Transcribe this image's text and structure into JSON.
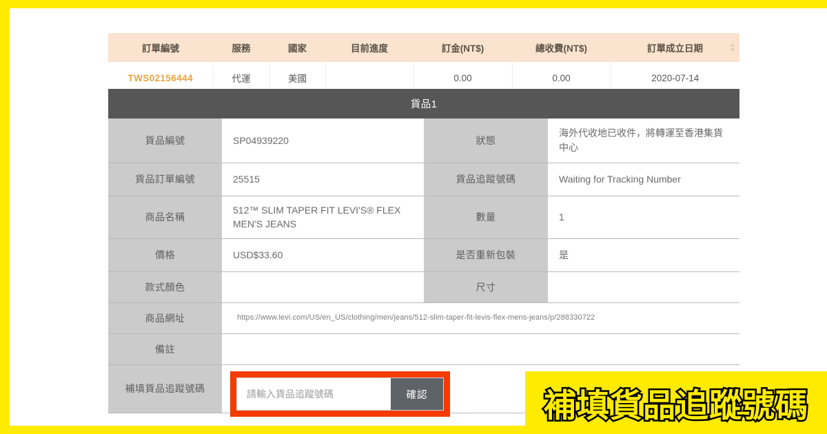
{
  "theme": {
    "banner_yellow": "#ffeb00",
    "header_peach": "#fae3cf",
    "order_number_orange": "#e9a33e",
    "item_bar_gray": "#565656",
    "label_gray": "#cbcbcb",
    "highlight_red": "#f43b00",
    "button_gray": "#5e6368"
  },
  "order_table": {
    "columns": [
      "訂單編號",
      "服務",
      "國家",
      "目前進度",
      "訂金(NT$)",
      "總收費(NT$)",
      "訂單成立日期"
    ],
    "sort_icon": "sort-arrows-icon",
    "row": {
      "order_number": "TWS02156444",
      "service": "代運",
      "country": "美國",
      "progress": "",
      "deposit": "0.00",
      "total_fee": "0.00",
      "created_date": "2020-07-14"
    }
  },
  "item_section": {
    "title": "貨品1",
    "rows": [
      {
        "label_left": "貨品編號",
        "value_left": "SP04939220",
        "label_right": "狀態",
        "value_right": "海外代收地已收件，將轉運至香港集貨中心"
      },
      {
        "label_left": "貨品訂單編號",
        "value_left": "25515",
        "label_right": "貨品追蹤號碼",
        "value_right": "Waiting for Tracking Number"
      },
      {
        "label_left": "商品名稱",
        "value_left": "512™ SLIM TAPER FIT LEVI'S® FLEX MEN'S JEANS",
        "label_right": "數量",
        "value_right": "1"
      },
      {
        "label_left": "價格",
        "value_left": "USD$33.60",
        "label_right": "是否重新包裝",
        "value_right": "是"
      },
      {
        "label_left": "款式顏色",
        "value_left": "",
        "label_right": "尺寸",
        "value_right": ""
      }
    ],
    "url_row": {
      "label": "商品網址",
      "value": "https://www.levi.com/US/en_US/clothing/men/jeans/512-slim-taper-fit-levis-flex-mens-jeans/p/288330722"
    },
    "remark_row": {
      "label": "備註",
      "value": ""
    },
    "tracking_row": {
      "label": "補填貨品追蹤號碼",
      "input_value": "",
      "input_placeholder": "請輸入貨品追蹤號碼",
      "confirm_label": "確認"
    }
  },
  "banner": {
    "caption": "補填貨品追蹤號碼"
  }
}
